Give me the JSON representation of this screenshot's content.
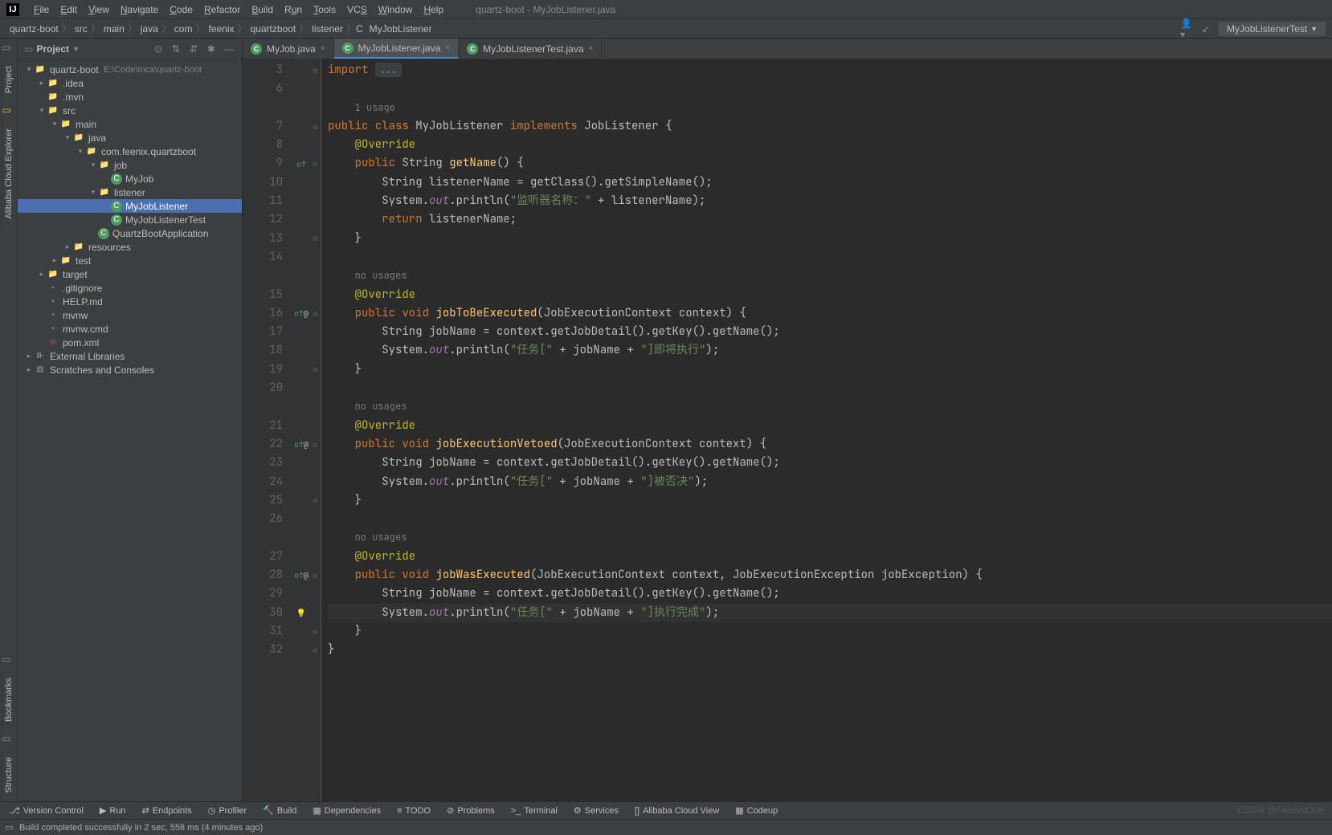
{
  "menubar": {
    "items": [
      {
        "label": "File",
        "u": "F"
      },
      {
        "label": "Edit",
        "u": "E"
      },
      {
        "label": "View",
        "u": "V"
      },
      {
        "label": "Navigate",
        "u": "N"
      },
      {
        "label": "Code",
        "u": "C"
      },
      {
        "label": "Refactor",
        "u": "R"
      },
      {
        "label": "Build",
        "u": "B"
      },
      {
        "label": "Run",
        "u": "u"
      },
      {
        "label": "Tools",
        "u": "T"
      },
      {
        "label": "VCS",
        "u": "S"
      },
      {
        "label": "Window",
        "u": "W"
      },
      {
        "label": "Help",
        "u": "H"
      }
    ],
    "title": "quartz-boot - MyJobListener.java"
  },
  "breadcrumbs": [
    "quartz-boot",
    "src",
    "main",
    "java",
    "com",
    "feenix",
    "quartzboot",
    "listener",
    "MyJobListener"
  ],
  "navRight": {
    "runConfig": "MyJobListenerTest"
  },
  "sidebar": {
    "title": "Project",
    "tree": [
      {
        "depth": 0,
        "tw": "v",
        "ic": "folder",
        "text": "quartz-boot",
        "hint": "E:\\Code\\mca\\quartz-boot"
      },
      {
        "depth": 1,
        "tw": ">",
        "ic": "folder",
        "text": ".idea"
      },
      {
        "depth": 1,
        "tw": "",
        "ic": "folder",
        "text": ".mvn"
      },
      {
        "depth": 1,
        "tw": "v",
        "ic": "src",
        "text": "src"
      },
      {
        "depth": 2,
        "tw": "v",
        "ic": "folder",
        "text": "main"
      },
      {
        "depth": 3,
        "tw": "v",
        "ic": "java",
        "text": "java"
      },
      {
        "depth": 4,
        "tw": "v",
        "ic": "folder",
        "text": "com.feenix.quartzboot"
      },
      {
        "depth": 5,
        "tw": "v",
        "ic": "folder",
        "text": "job"
      },
      {
        "depth": 6,
        "tw": "",
        "ic": "cls",
        "text": "MyJob"
      },
      {
        "depth": 5,
        "tw": "v",
        "ic": "folder",
        "text": "listener"
      },
      {
        "depth": 6,
        "tw": "",
        "ic": "cls",
        "text": "MyJobListener",
        "sel": true
      },
      {
        "depth": 6,
        "tw": "",
        "ic": "cls",
        "text": "MyJobListenerTest"
      },
      {
        "depth": 5,
        "tw": "",
        "ic": "cls",
        "text": "QuartzBootApplication"
      },
      {
        "depth": 3,
        "tw": ">",
        "ic": "folder",
        "text": "resources"
      },
      {
        "depth": 2,
        "tw": ">",
        "ic": "folder",
        "text": "test"
      },
      {
        "depth": 1,
        "tw": ">",
        "ic": "orange",
        "text": "target"
      },
      {
        "depth": 1,
        "tw": "",
        "ic": "file",
        "text": ".gitignore"
      },
      {
        "depth": 1,
        "tw": "",
        "ic": "file",
        "text": "HELP.md"
      },
      {
        "depth": 1,
        "tw": "",
        "ic": "file",
        "text": "mvnw"
      },
      {
        "depth": 1,
        "tw": "",
        "ic": "file",
        "text": "mvnw.cmd"
      },
      {
        "depth": 1,
        "tw": "",
        "ic": "red",
        "text": "pom.xml"
      },
      {
        "depth": 0,
        "tw": ">",
        "ic": "lib",
        "text": "External Libraries"
      },
      {
        "depth": 0,
        "tw": ">",
        "ic": "scratch",
        "text": "Scratches and Consoles"
      }
    ]
  },
  "leftTabs": [
    "Project",
    "Alibaba Cloud Explorer",
    "Bookmarks",
    "Structure"
  ],
  "tabs": [
    {
      "label": "MyJob.java",
      "active": false
    },
    {
      "label": "MyJobListener.java",
      "active": true
    },
    {
      "label": "MyJobListenerTest.java",
      "active": false
    }
  ],
  "editor": {
    "lineStart": 3,
    "lines": [
      {
        "n": 3,
        "fold": "+",
        "html": "<span class='kw'>import</span> <span class='importbox'>...</span>"
      },
      {
        "n": 6,
        "html": ""
      },
      {
        "hint": "1 usage"
      },
      {
        "n": 7,
        "fold": "-",
        "html": "<span class='kw'>public class</span> MyJobListener <span class='kw'>implements</span> JobListener {"
      },
      {
        "n": 8,
        "html": "    <span class='ann'>@Override</span>"
      },
      {
        "n": 9,
        "mark": "ov",
        "fold": "-",
        "html": "    <span class='kw'>public</span> String <span class='fnDecl'>getName</span>() {"
      },
      {
        "n": 10,
        "html": "        String listenerName = getClass().getSimpleName();"
      },
      {
        "n": 11,
        "html": "        System.<span class='static'>out</span>.println(<span class='str'>\"监听器名称：\"</span> + listenerName);"
      },
      {
        "n": 12,
        "html": "        <span class='kw'>return</span> listenerName;"
      },
      {
        "n": 13,
        "fold": "-",
        "html": "    }"
      },
      {
        "n": 14,
        "html": ""
      },
      {
        "hint": "no usages"
      },
      {
        "n": 15,
        "html": "    <span class='ann'>@Override</span>"
      },
      {
        "n": 16,
        "mark": "ov at",
        "fold": "-",
        "html": "    <span class='kw'>public void</span> <span class='fnDecl'>jobToBeExecuted</span>(JobExecutionContext context) {"
      },
      {
        "n": 17,
        "html": "        String jobName = context.getJobDetail().getKey().getName();"
      },
      {
        "n": 18,
        "html": "        System.<span class='static'>out</span>.println(<span class='str'>\"任务[\"</span> + jobName + <span class='str'>\"]即将执行\"</span>);"
      },
      {
        "n": 19,
        "fold": "-",
        "html": "    }"
      },
      {
        "n": 20,
        "html": ""
      },
      {
        "hint": "no usages"
      },
      {
        "n": 21,
        "html": "    <span class='ann'>@Override</span>"
      },
      {
        "n": 22,
        "mark": "ov at",
        "fold": "-",
        "html": "    <span class='kw'>public void</span> <span class='fnDecl'>jobExecutionVetoed</span>(JobExecutionContext context) {"
      },
      {
        "n": 23,
        "html": "        String jobName = context.getJobDetail().getKey().getName();"
      },
      {
        "n": 24,
        "html": "        System.<span class='static'>out</span>.println(<span class='str'>\"任务[\"</span> + jobName + <span class='str'>\"]被否决\"</span>);"
      },
      {
        "n": 25,
        "fold": "-",
        "html": "    }"
      },
      {
        "n": 26,
        "html": ""
      },
      {
        "hint": "no usages"
      },
      {
        "n": 27,
        "html": "    <span class='ann'>@Override</span>"
      },
      {
        "n": 28,
        "mark": "ov at",
        "fold": "-",
        "html": "    <span class='kw'>public void</span> <span class='fnDecl'>jobWasExecuted</span>(JobExecutionContext context, JobExecutionException jobException) {"
      },
      {
        "n": 29,
        "html": "        String jobName = context.getJobDetail().getKey().getName();"
      },
      {
        "n": 30,
        "mark": "bulb",
        "cur": true,
        "html": "        System.<span class='static'>out</span>.println(<span class='str'>\"任务[\"</span> + jobName + <span class='str'>\"]执行完成\"</span>);"
      },
      {
        "n": 31,
        "fold": "-",
        "html": "    }"
      },
      {
        "n": 32,
        "fold": "-",
        "html": "}"
      }
    ]
  },
  "bottombar": [
    {
      "ic": "⎇",
      "label": "Version Control"
    },
    {
      "ic": "▶",
      "label": "Run"
    },
    {
      "ic": "⇄",
      "label": "Endpoints"
    },
    {
      "ic": "◷",
      "label": "Profiler"
    },
    {
      "ic": "🔨",
      "label": "Build"
    },
    {
      "ic": "▦",
      "label": "Dependencies"
    },
    {
      "ic": "≡",
      "label": "TODO"
    },
    {
      "ic": "⊘",
      "label": "Problems"
    },
    {
      "ic": ">_",
      "label": "Terminal"
    },
    {
      "ic": "⚙",
      "label": "Services"
    },
    {
      "ic": "[]",
      "label": "Alibaba Cloud View"
    },
    {
      "ic": "▦",
      "label": "Codeup"
    }
  ],
  "status": "Build completed successfully in 2 sec, 558 ms (4 minutes ago)",
  "watermark": "CSDN @FeenixOne"
}
